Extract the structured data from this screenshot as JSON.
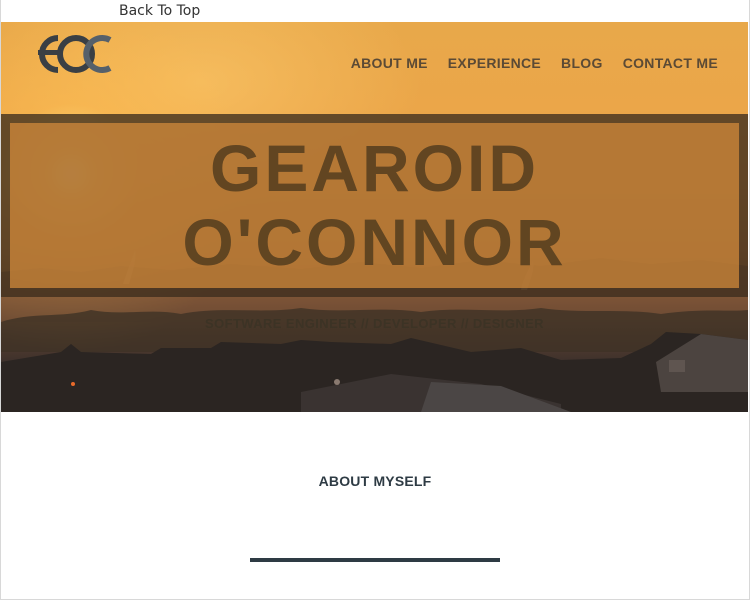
{
  "header": {
    "back_to_top": "Back To Top"
  },
  "logo": {
    "icon": "goc-monogram-logo"
  },
  "nav": {
    "items": [
      {
        "label": "ABOUT ME"
      },
      {
        "label": "EXPERIENCE"
      },
      {
        "label": "BLOG"
      },
      {
        "label": "CONTACT ME"
      }
    ]
  },
  "hero": {
    "name_line_1": "GEAROID",
    "name_line_2": "O'CONNOR",
    "tagline": "SOFTWARE ENGINEER // DEVELOPER // DESIGNER",
    "background": "sunset-over-rooftops-photo"
  },
  "about": {
    "title": "ABOUT MYSELF"
  },
  "colors": {
    "nav_text": "#5b4a35",
    "name_text": "#5b4120",
    "heading": "#2e3b44",
    "band_dark": "#3c2d1e"
  }
}
